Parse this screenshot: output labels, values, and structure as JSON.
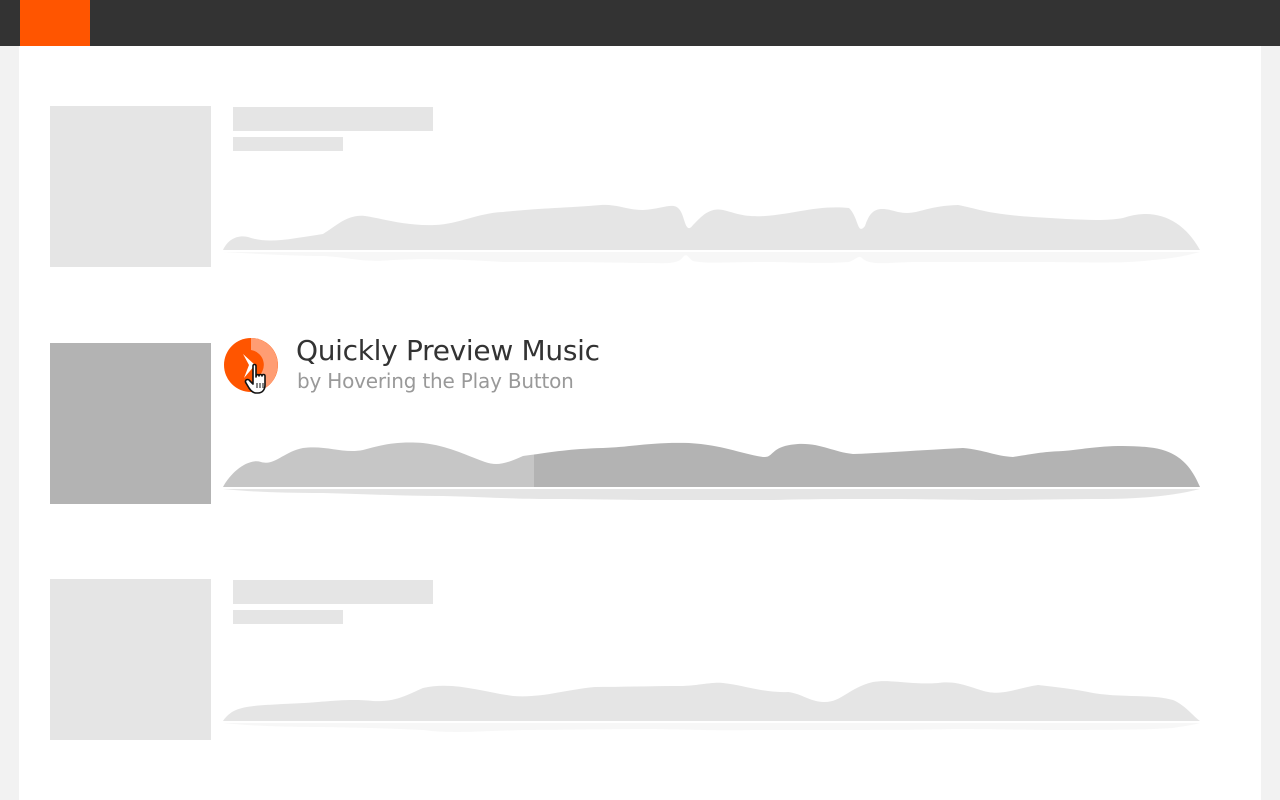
{
  "colors": {
    "accent": "#ff5500",
    "topbar": "#333333",
    "placeholder": "#e5e5e5",
    "placeholder_dark": "#b3b3b3",
    "played_wave": "#c6c6c6"
  },
  "header": {
    "logo_icon": "logo-icon"
  },
  "tracks": [
    {
      "state": "placeholder"
    },
    {
      "state": "active",
      "title": "Quickly Preview Music",
      "subtitle": "by Hovering the Play Button",
      "play_icon": "play-icon",
      "cursor_icon": "hand-pointer-icon"
    },
    {
      "state": "placeholder"
    }
  ]
}
